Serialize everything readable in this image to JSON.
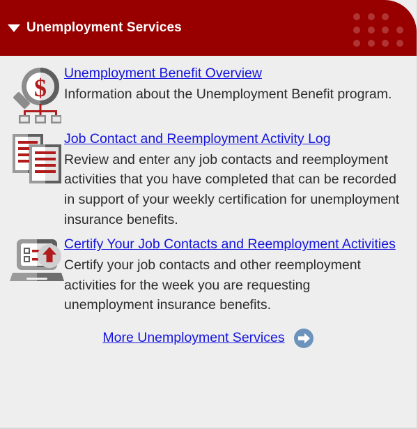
{
  "header": {
    "title": "Unemployment Services",
    "caret_icon": "caret-down-icon",
    "dot_pattern_icon": "dot-grid-decoration",
    "bg_color": "#980000",
    "text_color": "#ffffff",
    "dot_color": "#b03434"
  },
  "theme": {
    "panel_background": "#eeeeee",
    "link_color": "#1414dd",
    "body_text_color": "#2b2b2b",
    "accent_red": "#980000",
    "icon_red": "#b01c1c",
    "icon_gray": "#7a7a7a",
    "arrow_badge_color": "#6b93bb"
  },
  "services": [
    {
      "icon": "magnifier-dollar-icon",
      "link": "Unemployment Benefit Overview",
      "description": "Information about the Unemployment Benefit program."
    },
    {
      "icon": "documents-log-icon",
      "link": "Job Contact and Reemployment Activity Log",
      "description": "Review and enter any job contacts and reemployment activities that you have completed that can be recorded in support of your weekly certification for unemployment insurance benefits."
    },
    {
      "icon": "laptop-upload-certify-icon",
      "link": "Certify Your Job Contacts and Reemployment Activities",
      "description": "Certify your job contacts and other reemployment activities for the week you are requesting unemployment insurance benefits."
    }
  ],
  "footer": {
    "link": "More Unemployment Services",
    "arrow_icon": "arrow-right-circle-icon"
  }
}
